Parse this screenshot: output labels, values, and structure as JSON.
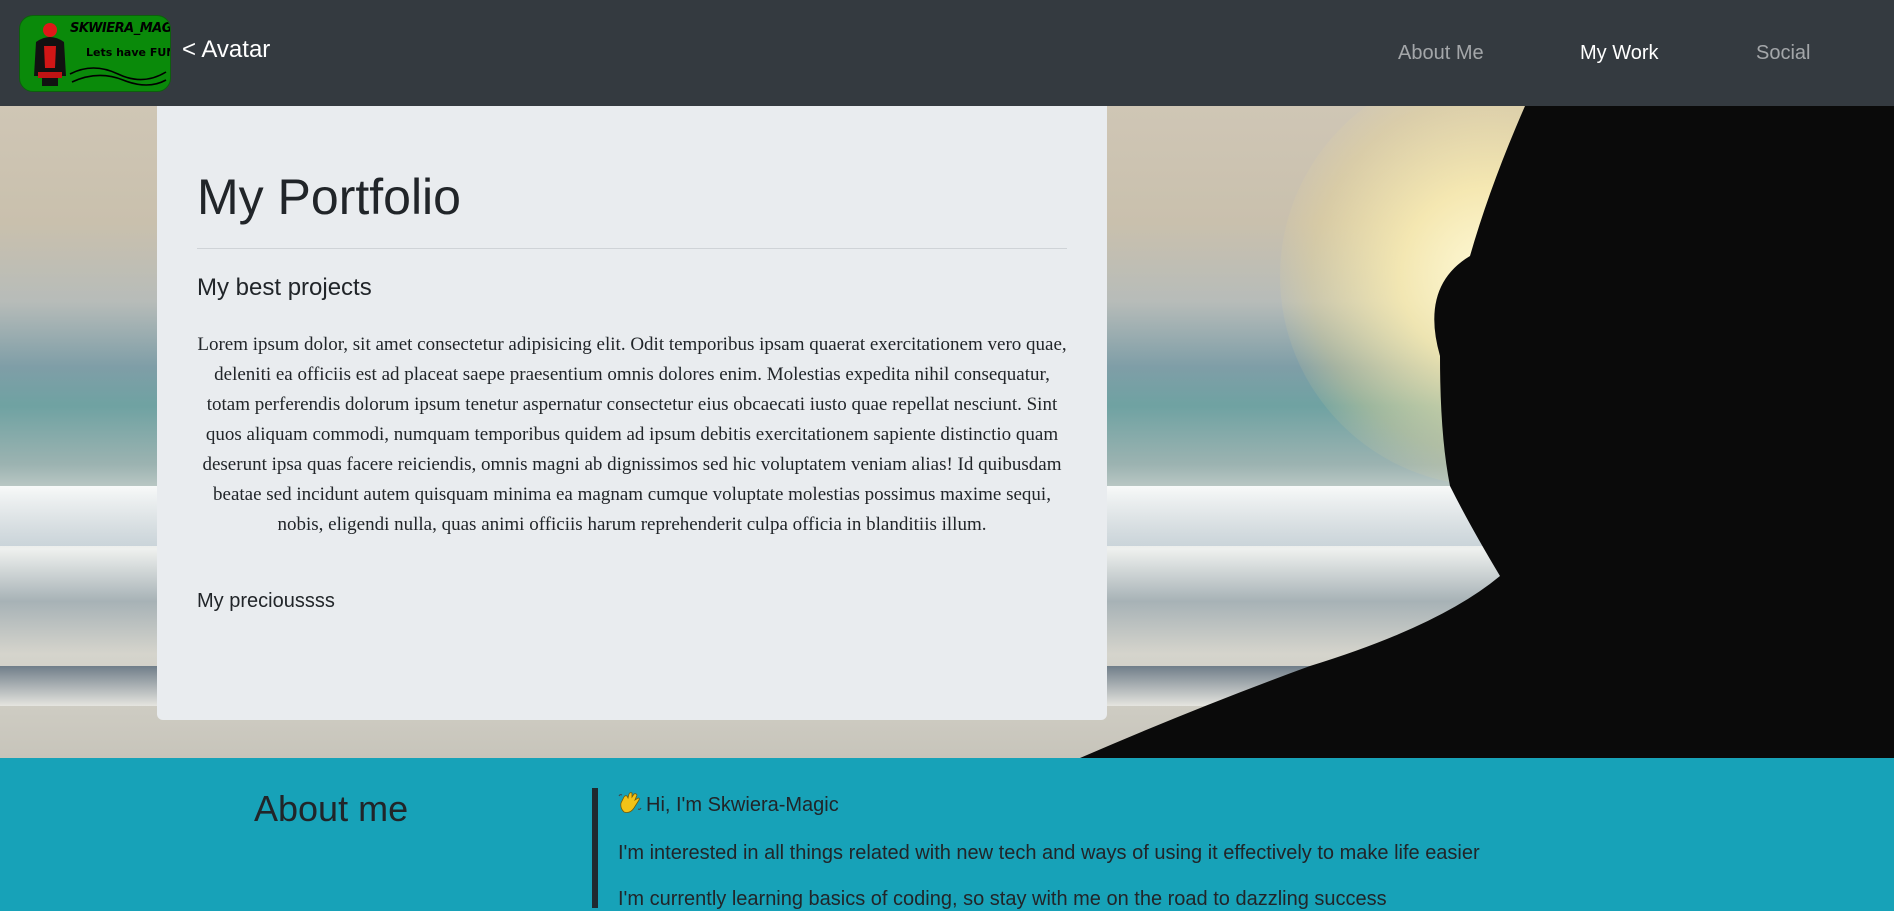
{
  "navbar": {
    "logo": {
      "title": "SKWIERA_MAGIC",
      "subtitle": "Lets have FUN"
    },
    "brand_link": "< Avatar",
    "items": [
      {
        "label": "About Me",
        "active": false
      },
      {
        "label": "My Work",
        "active": true
      },
      {
        "label": "Social",
        "active": false
      }
    ]
  },
  "portfolio": {
    "title": "My Portfolio",
    "subtitle": "My best projects",
    "text": "Lorem ipsum dolor, sit amet consectetur adipisicing elit. Odit temporibus ipsam quaerat exercitationem vero quae, deleniti ea officiis est ad placeat saepe praesentium omnis dolores enim. Molestias expedita nihil consequatur, totam perferendis dolorum ipsum tenetur aspernatur consectetur eius obcaecati iusto quae repellat nesciunt. Sint quos aliquam commodi, numquam temporibus quidem ad ipsum debitis exercitationem sapiente distinctio quam deserunt ipsa quas facere reiciendis, omnis magni ab dignissimos sed hic voluptatem veniam alias! Id quibusdam beatae sed incidunt autem quisquam minima ea magnam cumque voluptate molestias possimus maxime sequi, nobis, eligendi nulla, quas animi officiis harum reprehenderit culpa officia in blanditiis illum.",
    "footer": "My precioussss"
  },
  "about": {
    "heading": "About me",
    "greeting": "Hi, I'm Skwiera-Magic",
    "line1": "I'm interested in all things related with new tech and ways of using it effectively to make life easier",
    "line2": "I'm currently learning basics of coding, so stay with me on the road to dazzling success"
  },
  "colors": {
    "navbar_bg": "#343a40",
    "card_bg": "#e9ecef",
    "about_bg": "#17a2b8",
    "text": "#212529"
  },
  "icons": {
    "greeting": "waving-hand-icon",
    "logo": "skwiera-magic-logo"
  }
}
